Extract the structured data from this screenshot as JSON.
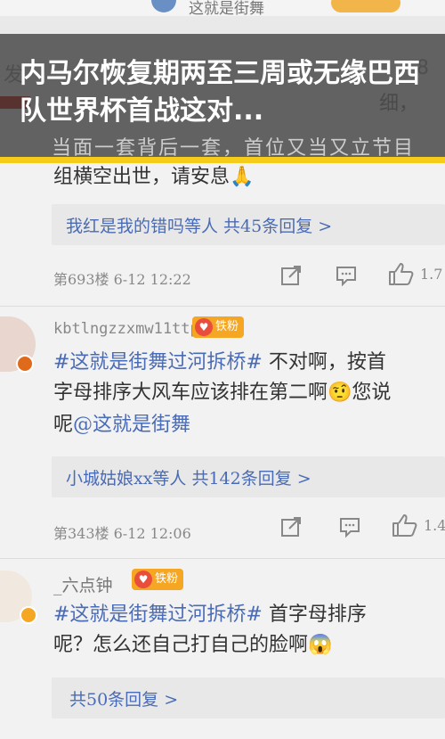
{
  "header": {
    "top_user_text": "这就是街舞",
    "headline": "内马尔恢复期两至三周或无缘巴西队世界杯首战这对...",
    "underlap_text": "当面一套背后一套，首位又当又立节目",
    "ghost_left": "发",
    "ghost_right": "8",
    "ghost_row2": "细，"
  },
  "comments": [
    {
      "id": "c1",
      "text_line2": "组横空出世，请安息🙏",
      "replies_label": "我红是我的错吗等人  共45条回复 >",
      "floor_meta": "第693楼 6-12 12:22",
      "like_count": "1.7"
    },
    {
      "id": "c2",
      "username": "kbtlngzzxmw11ttp",
      "badge": "铁粉",
      "hashtag": "#这就是街舞过河拆桥#",
      "text_line1_rest": " 不对啊，按首",
      "text_line2": "字母排序大风车应该排在第二啊🤨您说",
      "text_line3_pre": "呢",
      "mention": "@这就是街舞",
      "replies_label": "小城姑娘xx等人  共142条回复 >",
      "floor_meta": "第343楼 6-12 12:06",
      "like_count": "1.4"
    },
    {
      "id": "c3",
      "username": "_六点钟",
      "badge": "铁粉",
      "hashtag": "#这就是街舞过河拆桥#",
      "text_line1_rest": " 首字母排序",
      "text_line2": "呢？怎么还自己打自己的脸啊😱",
      "replies_label": "共50条回复 >"
    }
  ],
  "icons": [
    "share-icon",
    "comment-icon",
    "like-icon"
  ],
  "colors": {
    "accent_yellow": "#f5cc1a",
    "link_blue": "#4a6bb5",
    "badge_orange": "#f5a623"
  }
}
